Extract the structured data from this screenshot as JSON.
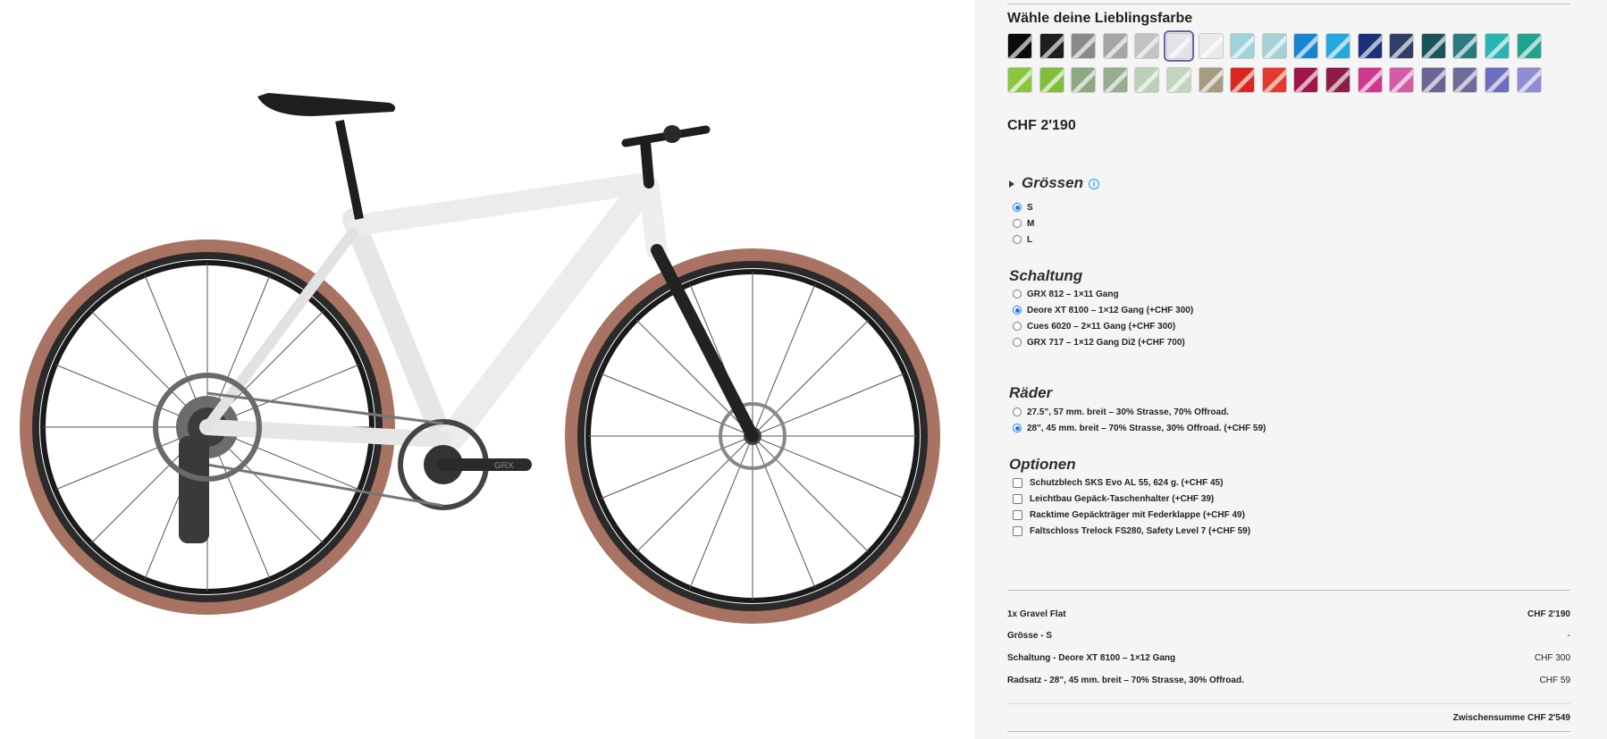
{
  "colors": {
    "row1": [
      "#0b0b0b",
      "#1e1e1e",
      "#8a8a8a",
      "#a6a6a6",
      "#c3c3c3",
      "#e2e4ea",
      "#e9eaec",
      "#9fd3dc",
      "#a4d0d6",
      "#1786d0",
      "#23a7dd",
      "#1e2f7a",
      "#2f3f68",
      "#19535c",
      "#2a7a80",
      "#27b4b4",
      "#1fa28e"
    ],
    "row2": [
      "#8cc63f",
      "#7fbf3a",
      "#8ea883",
      "#97ad90",
      "#bcd0b8",
      "#c4d6bf",
      "#a59c82",
      "#d8281f",
      "#e23b2c",
      "#a0154a",
      "#8e1c47",
      "#d0378f",
      "#d45ca6",
      "#6a6496",
      "#6e6b9b",
      "#6d6ec0",
      "#8d8cd4"
    ]
  },
  "sections": {
    "farbe_title": "Wähle deine Lieblingsfarbe",
    "price": "CHF 2'190",
    "groessen_title": "Grössen",
    "groessen_info": "i",
    "groessen": [
      "S",
      "M",
      "L"
    ],
    "schaltung_title": "Schaltung",
    "schaltung": [
      "GRX 812 – 1×11 Gang",
      "Deore XT 8100 – 1×12 Gang (+CHF 300)",
      "Cues 6020 – 2×11 Gang (+CHF 300)",
      "GRX 717 – 1×12 Gang Di2 (+CHF 700)"
    ],
    "raeder_title": "Räder",
    "raeder": [
      "27.5\", 57 mm. breit – 30% Strasse, 70% Offroad.",
      "28\", 45 mm. breit – 70% Strasse, 30% Offroad. (+CHF 59)"
    ],
    "optionen_title": "Optionen",
    "optionen": [
      "Schutzblech SKS Evo AL 55, 624 g. (+CHF 45)",
      "Leichtbau Gepäck-Taschenhalter (+CHF 39)",
      "Racktime Gepäckträger mit Federklappe (+CHF 49)",
      "Faltschloss Trelock FS280, Safety Level 7 (+CHF 59)"
    ]
  },
  "summary": {
    "rows": [
      {
        "label": "1x Gravel Flat",
        "value": "CHF 2'190"
      },
      {
        "label": "Grösse - S",
        "value": "-"
      },
      {
        "label": "Schaltung - Deore XT 8100 – 1×12 Gang",
        "value": "CHF 300"
      },
      {
        "label": "Radsatz - 28\", 45 mm. breit – 70% Strasse, 30% Offroad.",
        "value": "CHF 59"
      }
    ],
    "subtotal": "Zwischensumme CHF 2'549"
  },
  "bike": {
    "frame_color": "#f0f0f0",
    "tire_color": "#b07a63",
    "brand_mark": "GRX"
  }
}
